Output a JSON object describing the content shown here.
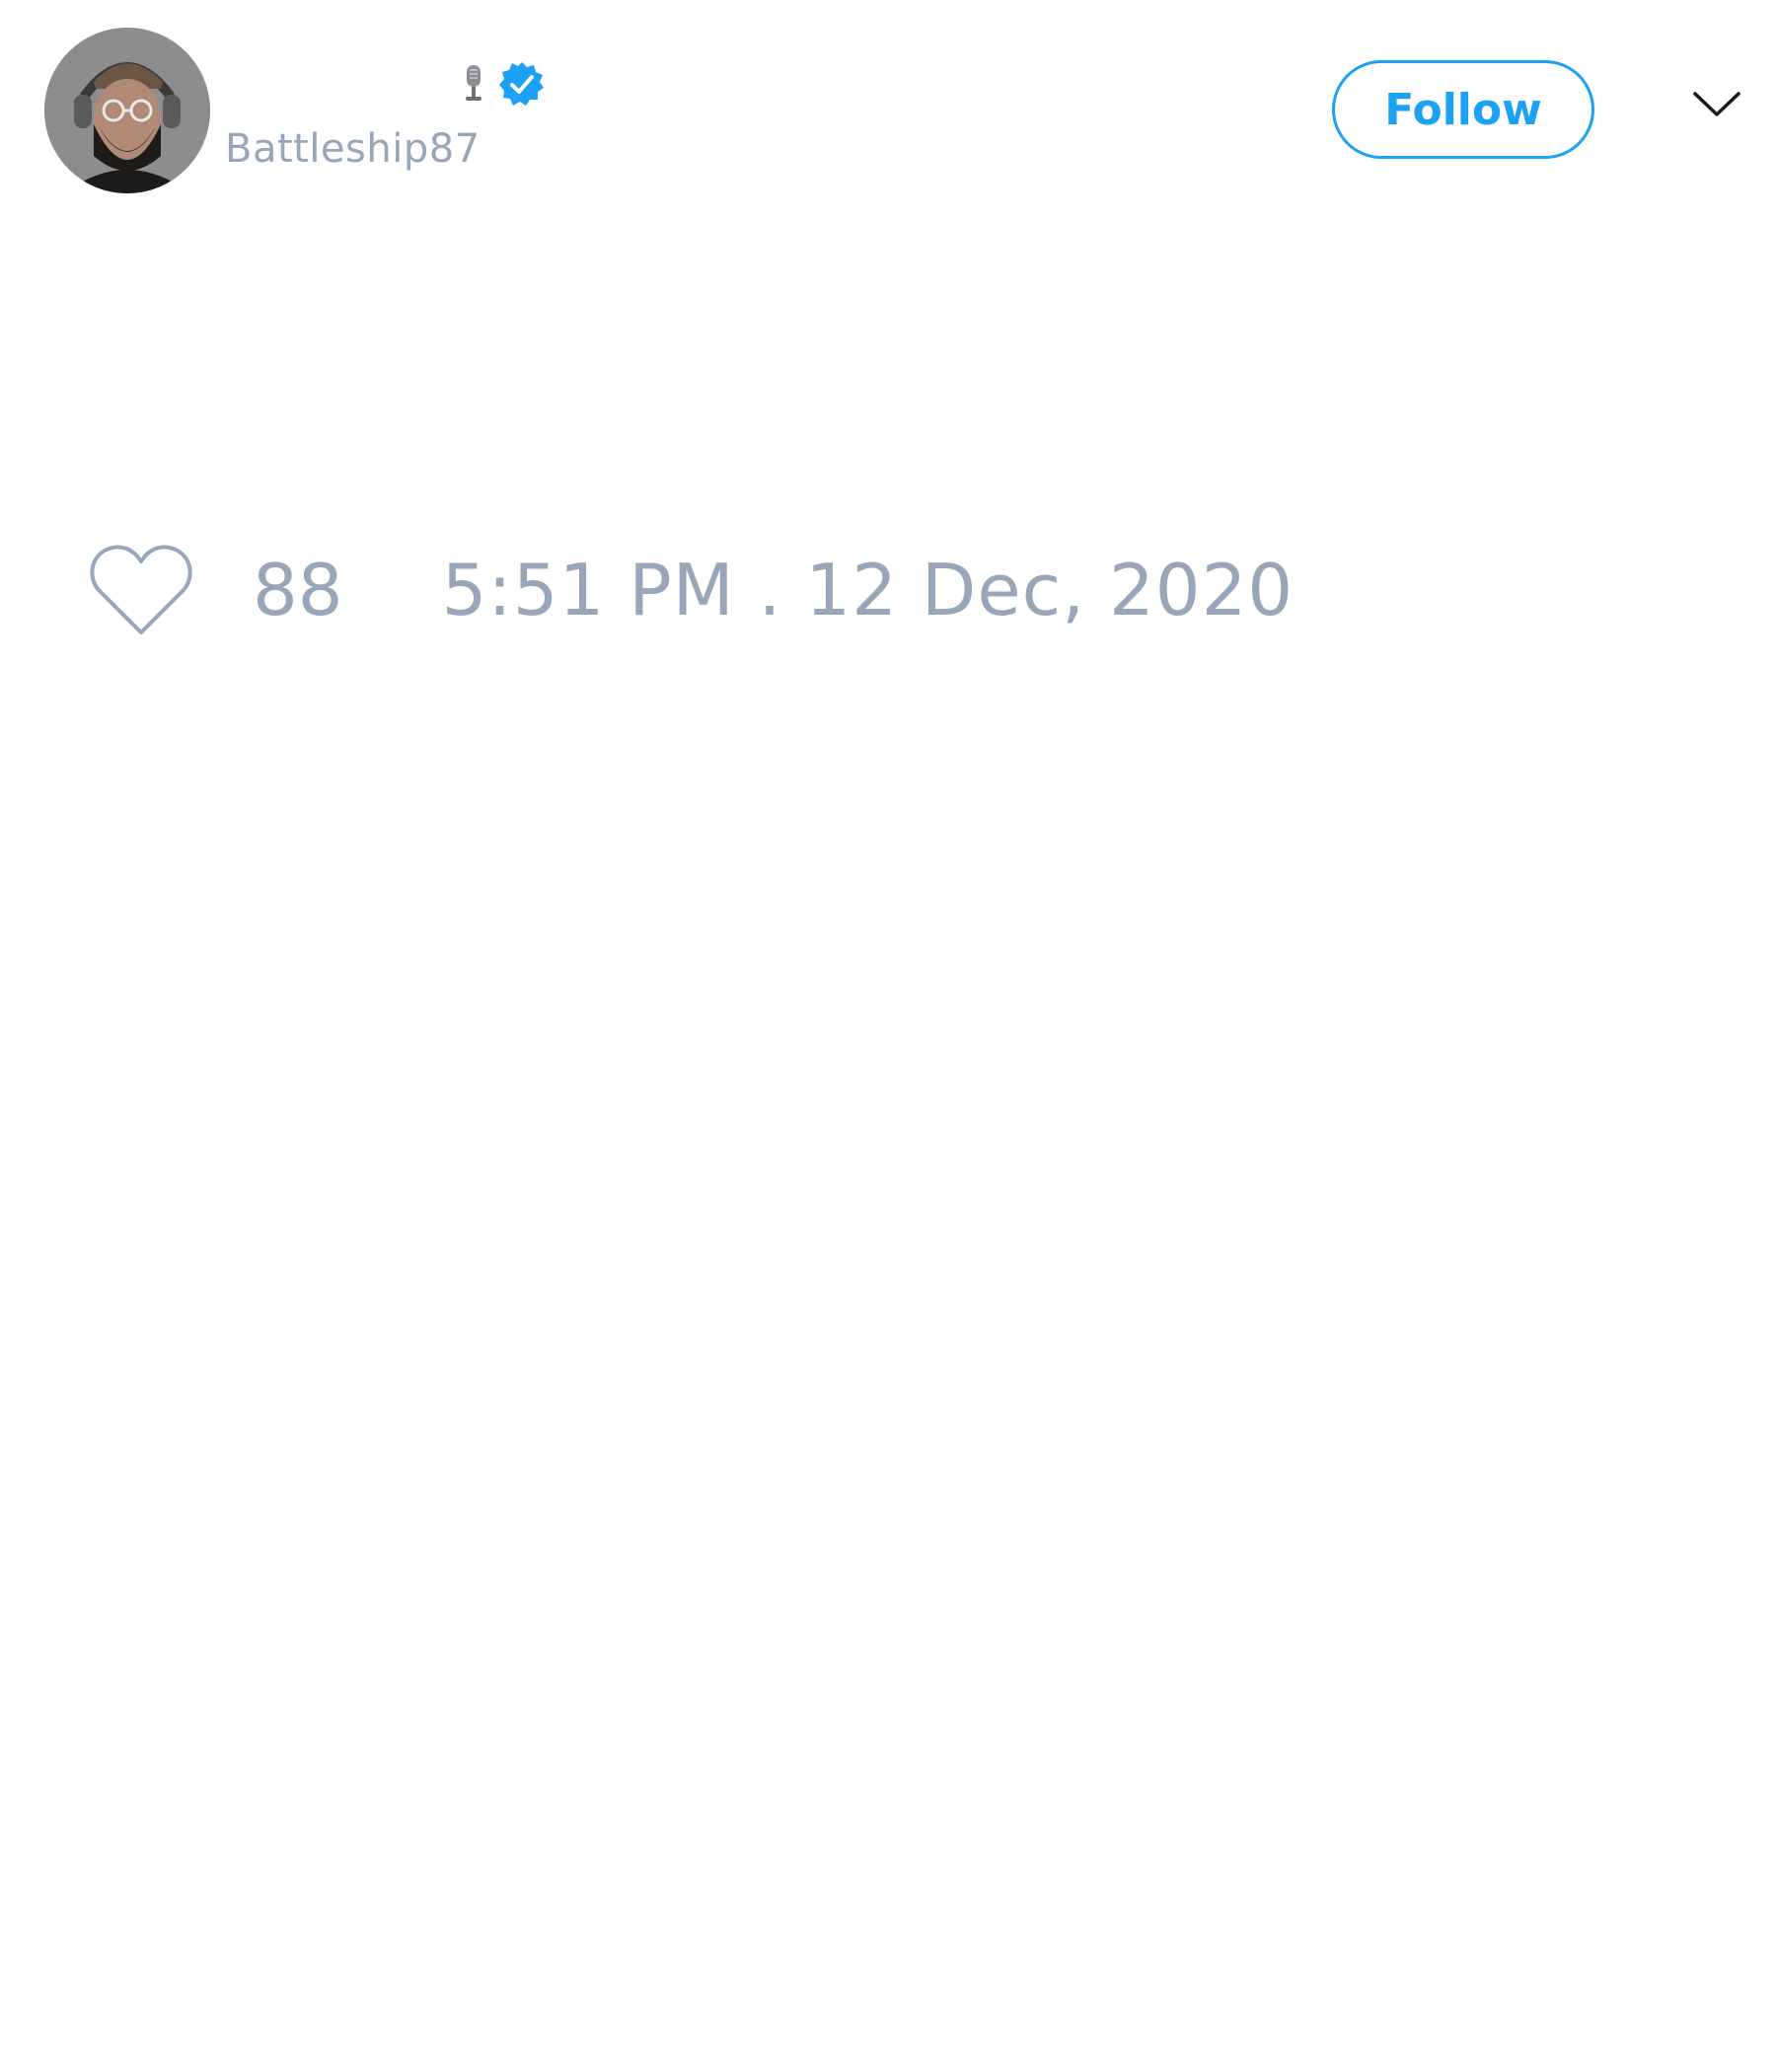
{
  "tweet": {
    "author": {
      "display_name": "",
      "handle": "Battleship87",
      "avatar_icon": "profile-photo",
      "name_emoji_icon": "microphone-icon",
      "verified": true,
      "verified_icon": "verified-badge-icon"
    },
    "follow_button_label": "Follow",
    "menu_icon": "chevron-down-icon",
    "likes": {
      "icon": "heart-outline-icon",
      "count": "88"
    },
    "timestamp": "5:51 PM . 12 Dec, 2020"
  },
  "colors": {
    "accent": "#1da1f2",
    "muted_text": "#98a6ba",
    "background": "#ffffff"
  }
}
